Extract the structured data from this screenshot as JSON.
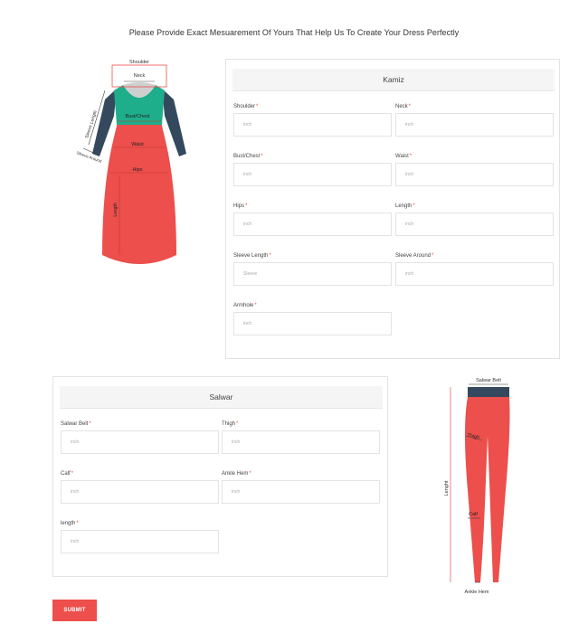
{
  "page": {
    "heading": "Please Provide Exact Mesuarement Of Yours That Help Us To Create Your Dress Perfectly",
    "submit_label": "SUBMIT"
  },
  "kamiz": {
    "title": "Kamiz",
    "fields": [
      {
        "label": "Shoulder",
        "required": "*",
        "placeholder": "inch"
      },
      {
        "label": "Neck",
        "required": "*",
        "placeholder": "inch"
      },
      {
        "label": "Bust/Chest",
        "required": "*",
        "placeholder": "inch"
      },
      {
        "label": "Waist",
        "required": "*",
        "placeholder": "inch"
      },
      {
        "label": "Hips",
        "required": "*",
        "placeholder": "inch"
      },
      {
        "label": "Length",
        "required": "*",
        "placeholder": "inch"
      },
      {
        "label": "Sleeve Length",
        "required": "*",
        "placeholder": "Sleeve"
      },
      {
        "label": "Sleeve Around",
        "required": "*",
        "placeholder": "inch"
      },
      {
        "label": "Armhole",
        "required": "*",
        "placeholder": "inch"
      }
    ]
  },
  "salwar": {
    "title": "Salwar",
    "fields": [
      {
        "label": "Salwar Belt",
        "required": "*",
        "placeholder": "inch"
      },
      {
        "label": "Thigh",
        "required": "*",
        "placeholder": "inch"
      },
      {
        "label": "Calf",
        "required": "*",
        "placeholder": "inch"
      },
      {
        "label": "Ankle Hem",
        "required": "*",
        "placeholder": "inch"
      },
      {
        "label": "length",
        "required": "*",
        "placeholder": "inch"
      }
    ]
  },
  "kamiz_diagram": {
    "shoulder": "Shoulder",
    "neck": "Neck",
    "bust": "Bust/Chest",
    "waist": "Waist",
    "hips": "Hips",
    "length": "Length",
    "sleeve_length": "Sleeve Length",
    "sleeve_around": "Sleeve Around"
  },
  "salwar_diagram": {
    "belt": "Salwar Belt",
    "thigh": "Thigh",
    "length": "Lenght",
    "calf": "Calf",
    "ankle": "Ankle Hem"
  },
  "colors": {
    "accent": "#ec4f4c",
    "teal": "#1fae8b",
    "dark_slate": "#34495e",
    "panel_header": "#f5f5f5"
  }
}
